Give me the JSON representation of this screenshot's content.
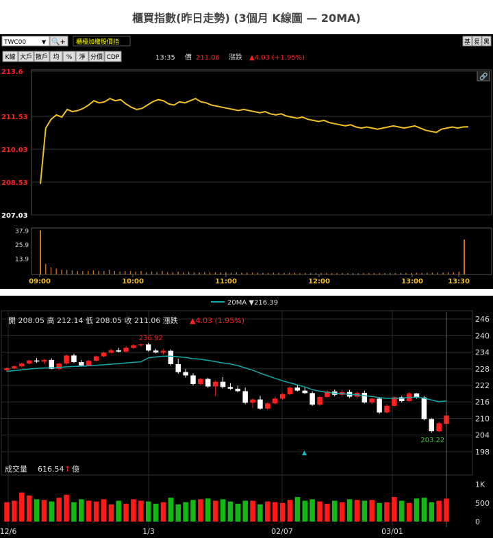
{
  "page_title": "櫃買指數(昨日走勢) (3個月 K線圖 — 20MA)",
  "toolbar": {
    "symbol": "TWC00",
    "tabs": [
      "K線",
      "大戶",
      "散戶",
      "均",
      "%",
      "淨",
      "分價",
      "CDP"
    ],
    "index_name": "櫃檯加權股價指",
    "time": "13:35",
    "price_label": "價",
    "price": "211.06",
    "change_label": "漲跌",
    "change": "▲4.03 (+1.95%)",
    "right_buttons": [
      "基",
      "易",
      "黑"
    ],
    "colors": {
      "up": "#ff2020",
      "down": "#ffffff",
      "line": "#f0c020",
      "accent": "#ffff00"
    }
  },
  "intraday": {
    "y_labels": [
      "213.6",
      "211.53",
      "210.03",
      "208.53",
      "207.03"
    ],
    "vol_labels": [
      "37.9",
      "25.9",
      "13.9"
    ],
    "x_labels": [
      "09:00",
      "10:00",
      "11:00",
      "12:00",
      "13:00",
      "13:30"
    ],
    "price_series": [
      208.45,
      211.0,
      211.4,
      211.6,
      211.5,
      211.85,
      211.75,
      211.8,
      211.9,
      212.05,
      212.25,
      212.15,
      212.2,
      212.35,
      212.25,
      212.3,
      212.1,
      211.95,
      211.85,
      211.9,
      212.05,
      212.2,
      212.3,
      212.25,
      212.1,
      212.05,
      212.2,
      212.15,
      212.25,
      212.35,
      212.2,
      212.15,
      212.05,
      212.0,
      211.95,
      211.9,
      211.85,
      211.8,
      211.85,
      211.8,
      211.75,
      211.7,
      211.75,
      211.65,
      211.6,
      211.65,
      211.55,
      211.5,
      211.45,
      211.5,
      211.4,
      211.35,
      211.3,
      211.35,
      211.25,
      211.2,
      211.15,
      211.1,
      211.15,
      211.05,
      211.0,
      211.05,
      211.0,
      210.95,
      211.0,
      211.05,
      211.1,
      211.05,
      211.0,
      211.05,
      211.1,
      211.0,
      210.9,
      210.85,
      210.8,
      210.95,
      211.0,
      211.05,
      211.0,
      211.05,
      211.06
    ],
    "volume_series": [
      37.9,
      9,
      6,
      5,
      4,
      4,
      3.5,
      3,
      3,
      3,
      3.5,
      3,
      3,
      4,
      3,
      2.5,
      3,
      3,
      2.5,
      3,
      2,
      2.5,
      2,
      3,
      2,
      2,
      2.5,
      2,
      2,
      2,
      1.8,
      2,
      2,
      1.8,
      1.8,
      2,
      1.6,
      1.8,
      1.5,
      1.6,
      1.6,
      1.5,
      1.5,
      1.4,
      1.6,
      1.5,
      1.4,
      1.4,
      1.5,
      1.3,
      1.4,
      1.3,
      1.3,
      1.4,
      1.3,
      1.2,
      1.3,
      1.3,
      1.2,
      1.3,
      1.2,
      1.3,
      1.2,
      1.2,
      1.3,
      1.2,
      1.3,
      1.2,
      1.3,
      1.4,
      1.3,
      1.5,
      1.4,
      1.5,
      1.6,
      1.6,
      1.7,
      1.8,
      2,
      2.5,
      30
    ]
  },
  "kchart": {
    "ma_legend": "20MA ▼216.39",
    "ohlc_header": "開 208.05  高 212.14  低 208.05  收 211.06  漲跌",
    "ohlc_change": "▲4.03 (1.95%)",
    "high_annotation": "236.92",
    "low_annotation": "203.22",
    "y_labels": [
      "246",
      "240",
      "234",
      "228",
      "222",
      "216",
      "210",
      "204",
      "198"
    ],
    "vol_label_prefix": "成交量",
    "vol_value": "616.54",
    "vol_arrow": "↑",
    "vol_unit": "億",
    "vol_axis": [
      "1K",
      "500",
      "0"
    ],
    "x_labels": [
      "12/6",
      "1/3",
      "02/07",
      "03/01"
    ]
  },
  "chart_data": [
    {
      "type": "line",
      "title": "櫃檯加權股價指",
      "x_ticks": [
        "09:00",
        "10:00",
        "11:00",
        "12:00",
        "13:00",
        "13:30"
      ],
      "ylim": [
        207.03,
        213.6
      ],
      "last_price": 211.06,
      "change": 4.03,
      "change_pct": 1.95
    },
    {
      "type": "candlestick",
      "x_ticks": [
        "12/6",
        "1/3",
        "02/07",
        "03/01"
      ],
      "ylim": [
        198,
        246
      ],
      "ma20_last": 216.39,
      "last_bar": {
        "open": 208.05,
        "high": 212.14,
        "low": 208.05,
        "close": 211.06
      },
      "period_high": 236.92,
      "period_low": 203.22,
      "last_volume": 616.54,
      "candles": [
        [
          227.5,
          228.5,
          226.8,
          228.2
        ],
        [
          228.2,
          229.2,
          227.8,
          228.9
        ],
        [
          228.9,
          230.2,
          228.5,
          229.9
        ],
        [
          229.9,
          231.2,
          229.6,
          231.0
        ],
        [
          231.0,
          231.9,
          230.1,
          230.6
        ],
        [
          230.6,
          231.5,
          229.8,
          231.2
        ],
        [
          231.2,
          231.8,
          227.8,
          228.0
        ],
        [
          228.0,
          230.2,
          227.5,
          229.9
        ],
        [
          229.9,
          233.2,
          229.5,
          232.8
        ],
        [
          232.8,
          233.5,
          230.1,
          230.4
        ],
        [
          230.4,
          231.2,
          228.8,
          229.2
        ],
        [
          229.2,
          231.2,
          228.9,
          230.9
        ],
        [
          230.9,
          232.8,
          230.6,
          232.5
        ],
        [
          232.5,
          234.2,
          232.2,
          233.8
        ],
        [
          233.8,
          235.2,
          233.5,
          234.7
        ],
        [
          234.7,
          235.6,
          233.9,
          234.2
        ],
        [
          234.2,
          236.2,
          233.9,
          235.6
        ],
        [
          235.6,
          236.9,
          235.2,
          236.5
        ],
        [
          236.5,
          237.2,
          236.0,
          236.8
        ],
        [
          236.8,
          237.4,
          234.2,
          234.6
        ],
        [
          234.6,
          235.2,
          233.6,
          233.9
        ],
        [
          233.9,
          235.0,
          233.2,
          234.5
        ],
        [
          234.5,
          235.0,
          229.2,
          229.7
        ],
        [
          229.7,
          231.6,
          226.2,
          226.8
        ],
        [
          226.8,
          227.9,
          224.8,
          225.6
        ],
        [
          225.6,
          226.4,
          221.9,
          222.5
        ],
        [
          222.5,
          224.8,
          222.1,
          224.3
        ],
        [
          224.3,
          224.8,
          221.1,
          221.6
        ],
        [
          221.6,
          223.8,
          218.1,
          223.3
        ],
        [
          223.3,
          225.0,
          220.9,
          221.4
        ],
        [
          221.4,
          222.8,
          220.4,
          220.8
        ],
        [
          220.8,
          221.9,
          219.5,
          219.9
        ],
        [
          219.9,
          221.2,
          215.2,
          215.7
        ],
        [
          215.7,
          217.2,
          213.8,
          216.9
        ],
        [
          216.9,
          218.2,
          213.2,
          213.6
        ],
        [
          213.6,
          215.8,
          213.2,
          215.5
        ],
        [
          215.5,
          217.9,
          215.1,
          217.2
        ],
        [
          217.2,
          219.2,
          216.8,
          218.8
        ],
        [
          218.8,
          221.6,
          218.5,
          221.2
        ],
        [
          221.2,
          222.2,
          219.8,
          220.1
        ],
        [
          220.1,
          221.2,
          218.8,
          219.2
        ],
        [
          219.2,
          219.8,
          214.6,
          215.0
        ],
        [
          215.0,
          218.2,
          214.6,
          217.8
        ],
        [
          217.8,
          220.2,
          217.5,
          219.8
        ],
        [
          219.8,
          220.5,
          218.0,
          218.6
        ],
        [
          218.6,
          220.2,
          217.9,
          219.6
        ],
        [
          219.6,
          220.3,
          217.4,
          217.9
        ],
        [
          217.9,
          219.8,
          217.3,
          219.3
        ],
        [
          219.3,
          220.1,
          215.5,
          215.8
        ],
        [
          215.8,
          217.5,
          215.2,
          217.2
        ],
        [
          217.2,
          217.8,
          211.7,
          212.2
        ],
        [
          212.2,
          215.2,
          211.9,
          214.6
        ],
        [
          214.6,
          218.1,
          214.3,
          217.7
        ],
        [
          217.7,
          218.2,
          215.8,
          216.3
        ],
        [
          216.3,
          219.6,
          216.1,
          219.1
        ],
        [
          219.1,
          219.2,
          217.2,
          217.6
        ],
        [
          217.6,
          218.1,
          209.3,
          209.8
        ],
        [
          209.8,
          210.2,
          204.9,
          205.4
        ],
        [
          205.4,
          208.8,
          205.1,
          208.3
        ],
        [
          208.05,
          212.14,
          208.05,
          211.06
        ]
      ],
      "volumes": [
        520,
        560,
        780,
        700,
        600,
        580,
        540,
        640,
        720,
        520,
        600,
        560,
        540,
        600,
        460,
        560,
        480,
        600,
        560,
        540,
        480,
        520,
        640,
        460,
        520,
        580,
        600,
        620,
        560,
        600,
        540,
        480,
        560,
        560,
        460,
        540,
        520,
        500,
        580,
        660,
        560,
        600,
        540,
        480,
        560,
        520,
        600,
        580,
        560,
        580,
        500,
        520,
        660,
        560,
        500,
        620,
        640,
        520,
        560,
        616.54
      ]
    }
  ]
}
